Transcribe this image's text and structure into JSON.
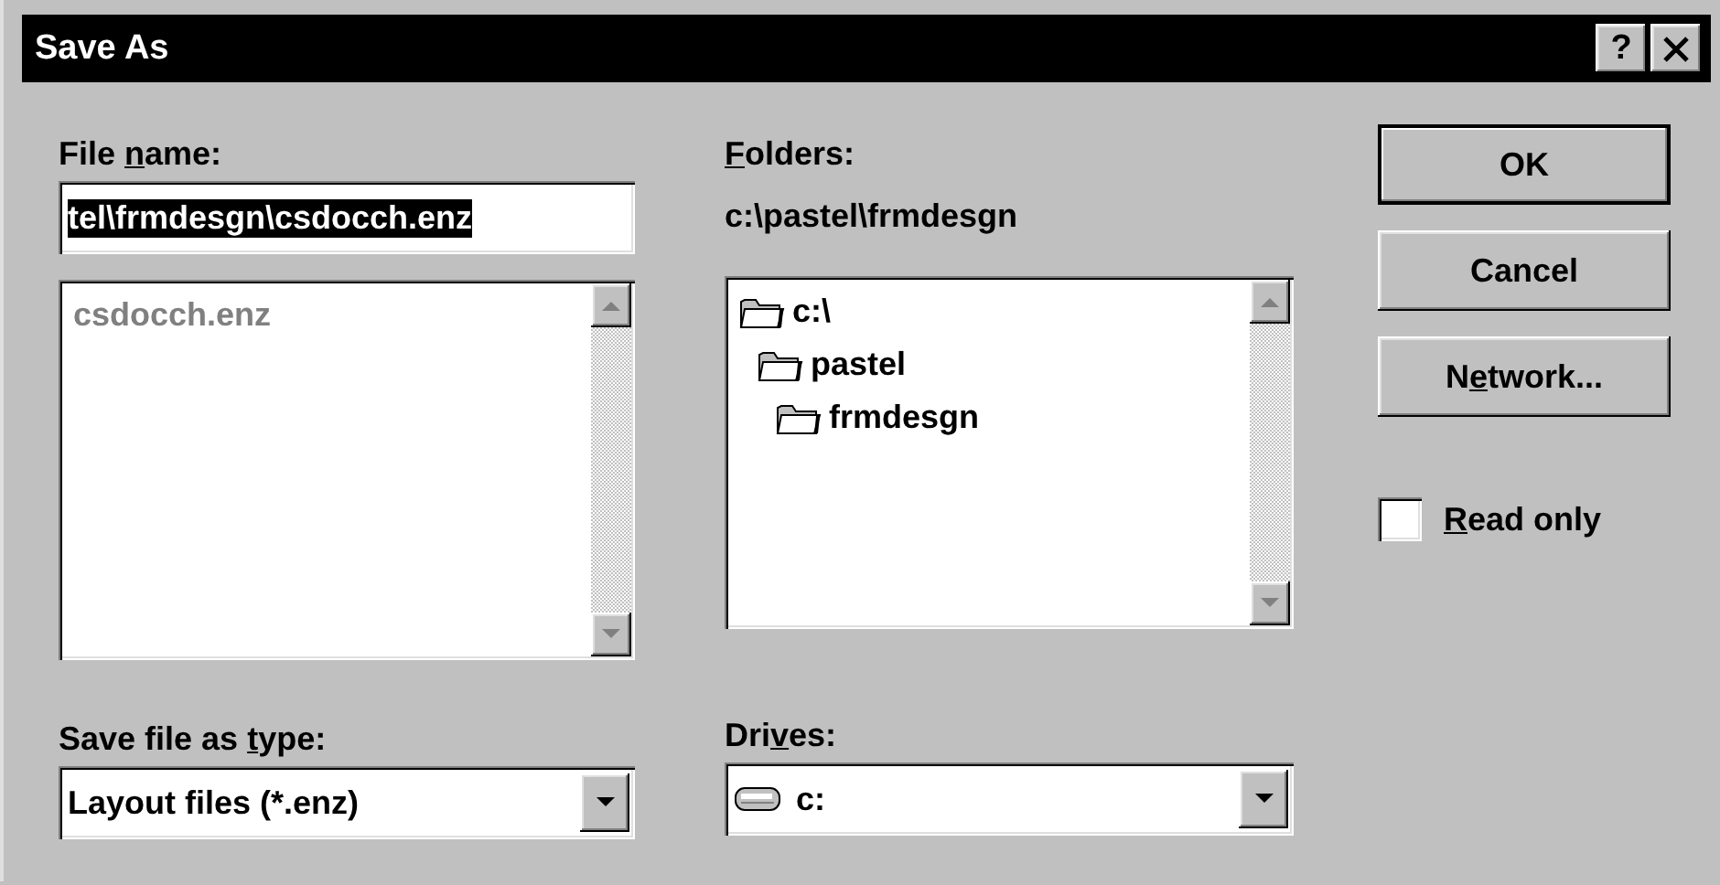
{
  "window": {
    "title": "Save As",
    "help_button": "?"
  },
  "file_name": {
    "label": [
      {
        "text": "File "
      },
      {
        "text": "n",
        "underlined": true
      },
      {
        "text": "ame:"
      }
    ],
    "value": "tel\\frmdesgn\\csdocch.enz",
    "text_selected": true
  },
  "file_list": {
    "items": [
      {
        "label": "csdocch.enz",
        "disabled": true
      }
    ]
  },
  "save_type": {
    "label": [
      {
        "text": "Save file as "
      },
      {
        "text": "t",
        "underlined": true
      },
      {
        "text": "ype:"
      }
    ],
    "value": "Layout files (*.enz)"
  },
  "folders": {
    "label": [
      {
        "text": "F",
        "underlined": true
      },
      {
        "text": "olders:"
      }
    ],
    "path": "c:\\pastel\\frmdesgn",
    "tree": [
      {
        "label": "c:\\",
        "children": [
          {
            "label": "pastel",
            "children": [
              {
                "label": "frmdesgn"
              }
            ]
          }
        ]
      }
    ]
  },
  "drives": {
    "label": [
      {
        "text": "Dri"
      },
      {
        "text": "v",
        "underlined": true
      },
      {
        "text": "es:"
      }
    ],
    "value": "c:"
  },
  "buttons": [
    {
      "label": [
        {
          "text": "OK"
        }
      ],
      "default": true
    },
    {
      "label": [
        {
          "text": "Cancel"
        }
      ],
      "default": false
    },
    {
      "label": [
        {
          "text": "N"
        },
        {
          "text": "e",
          "underlined": true
        },
        {
          "text": "twork..."
        }
      ],
      "default": false
    }
  ],
  "read_only": {
    "label": [
      {
        "text": "R",
        "underlined": true
      },
      {
        "text": "ead only"
      }
    ],
    "checked": false
  }
}
